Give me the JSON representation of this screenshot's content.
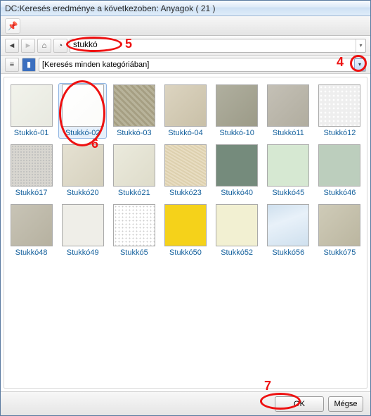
{
  "window": {
    "title": "DC:Keresés eredménye a következoben: Anyagok ( 21 )"
  },
  "toolbar": {
    "search_value": "stukkó"
  },
  "category": {
    "text": "[Keresés minden kategóriában]"
  },
  "buttons": {
    "ok": "OK",
    "cancel": "Mégse"
  },
  "annotations": {
    "a4": "4",
    "a5": "5",
    "a6": "6",
    "a7": "7"
  },
  "items": [
    {
      "label": "Stukkó-01",
      "bg": "linear-gradient(135deg,#f2f3ec,#e8e9e0)"
    },
    {
      "label": "Stukkó-02",
      "bg": "linear-gradient(135deg,#ffffff,#fbfbf9)",
      "selected": true
    },
    {
      "label": "Stukkó-03",
      "bg": "repeating-linear-gradient(45deg,#b8b39a 0 3px,#a59e82 3px 6px)"
    },
    {
      "label": "Stukkó-04",
      "bg": "linear-gradient(135deg,#dcd4c0,#c9c0a8)"
    },
    {
      "label": "Stukkó-10",
      "bg": "linear-gradient(135deg,#b0af9f,#9c9b88)"
    },
    {
      "label": "Stukkó11",
      "bg": "linear-gradient(135deg,#c4c0b6,#b1ad9f)"
    },
    {
      "label": "Stukkó12",
      "bg": "radial-gradient(circle,#fff 30%,#eee 31%) 0 0/6px 6px,#fff"
    },
    {
      "label": "Stukkó17",
      "bg": "radial-gradient(#bbb 1px,transparent 1px) 0 0/4px 4px,#d8d6d0"
    },
    {
      "label": "Stukkó20",
      "bg": "linear-gradient(135deg,#e5e1d2,#d6d1be)"
    },
    {
      "label": "Stukkó21",
      "bg": "linear-gradient(135deg,#ebeadd,#dedcca)"
    },
    {
      "label": "Stukkó23",
      "bg": "repeating-linear-gradient(30deg,#e8ddc2 0 2px,#ddd0ae 2px 4px)"
    },
    {
      "label": "Stukkó40",
      "bg": "#758b7c"
    },
    {
      "label": "Stukkó45",
      "bg": "#d6e8d2"
    },
    {
      "label": "Stukkó46",
      "bg": "#bccebd"
    },
    {
      "label": "Stukkó48",
      "bg": "linear-gradient(135deg,#c8c4b6,#b6b1a0)"
    },
    {
      "label": "Stukkó49",
      "bg": "#efeee8"
    },
    {
      "label": "Stukkó5",
      "bg": "radial-gradient(#ccc 1px,transparent 1px) 0 0/5px 5px,#fff"
    },
    {
      "label": "Stukkó50",
      "bg": "#f5d21a"
    },
    {
      "label": "Stukkó52",
      "bg": "#f2f0d2"
    },
    {
      "label": "Stukkó56",
      "bg": "linear-gradient(160deg,#cfe0ee,#e8f1f9 40%,#cfe0ee)"
    },
    {
      "label": "Stukkó75",
      "bg": "linear-gradient(135deg,#cfcbb8,#bbb6a0)"
    }
  ]
}
